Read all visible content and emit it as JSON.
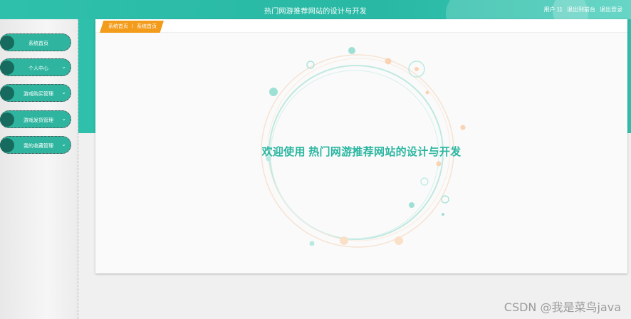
{
  "header": {
    "title": "热门网游推荐网站的设计与开发",
    "user": "用户 11",
    "back_to_frontend": "退出到前台",
    "logout": "退出登录"
  },
  "sidebar": {
    "items": [
      {
        "label": "系统首页",
        "has_chevron": false
      },
      {
        "label": "个人中心",
        "has_chevron": true
      },
      {
        "label": "游戏购买管理",
        "has_chevron": true
      },
      {
        "label": "游戏发货管理",
        "has_chevron": true
      },
      {
        "label": "我的收藏管理",
        "has_chevron": true
      }
    ]
  },
  "breadcrumb": {
    "root": "系统首页",
    "separator": "/",
    "current": "系统首页"
  },
  "main": {
    "welcome": "欢迎使用 热门网游推荐网站的设计与开发"
  },
  "watermark": "CSDN @我是菜鸟java",
  "colors": {
    "accent": "#2ec0aa",
    "dark_knob": "#176b5e",
    "crumb_bg": "#f39b1a"
  }
}
